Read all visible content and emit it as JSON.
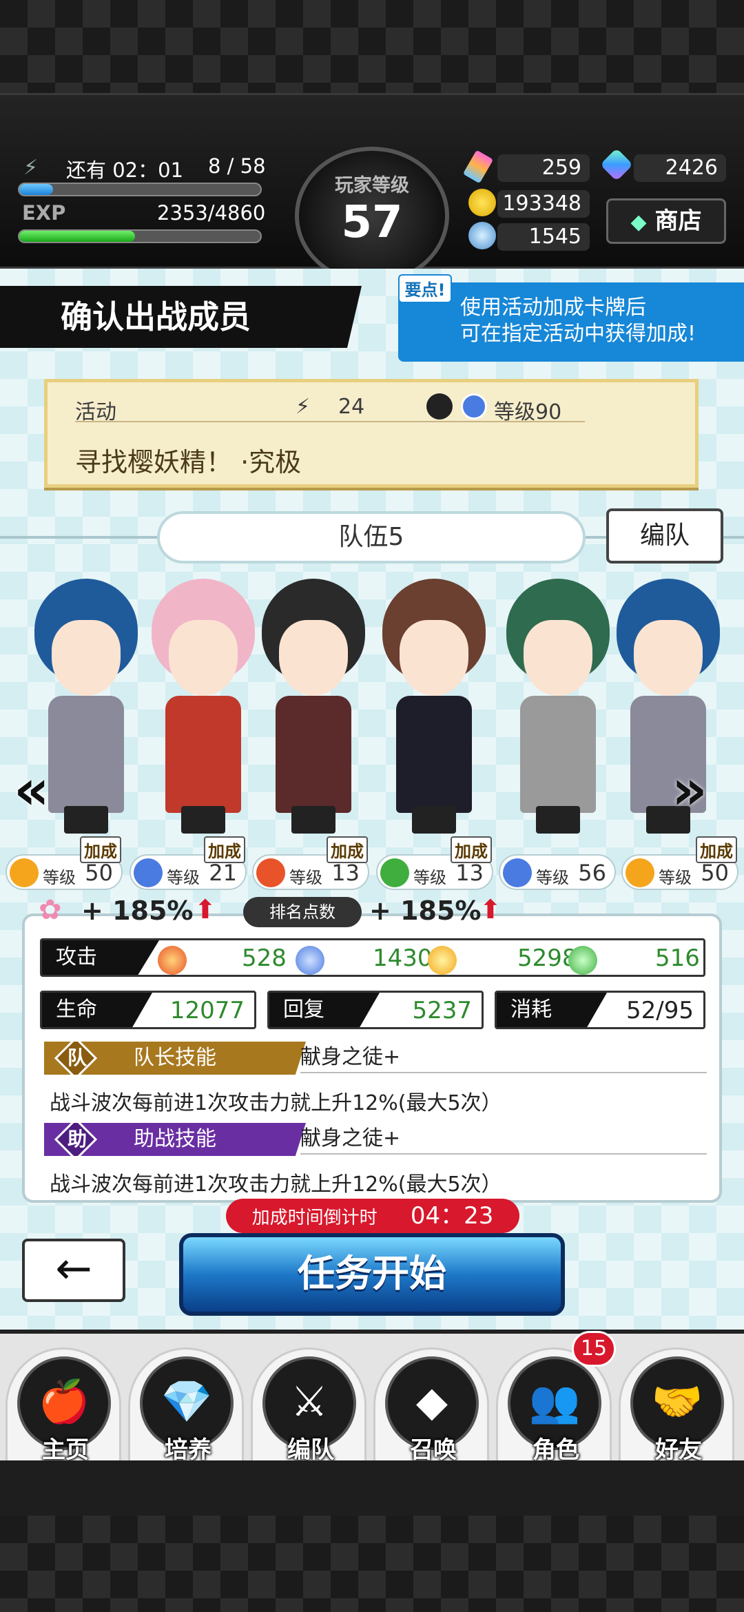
{
  "status": {
    "stamina_timer": "还有 02：01",
    "stamina_value": "8 / 58",
    "stamina_fraction": 0.14,
    "exp_label": "EXP",
    "exp_value": "2353/4860",
    "exp_fraction": 0.48,
    "level_label": "玩家等级",
    "level_value": "57",
    "resource_1": "259",
    "resource_gems": "2426",
    "resource_coins": "193348",
    "resource_orbs": "1545",
    "shop_label": "商店"
  },
  "header": {
    "title": "确认出战成员",
    "tip_badge": "要点!",
    "tip_line1": "使用活动加成卡牌后",
    "tip_line2": "可在指定活动中获得加成!"
  },
  "event": {
    "label": "活动",
    "stamina_cost": "24",
    "level_req": "等级90",
    "name": "寻找樱妖精！ ·究极"
  },
  "team": {
    "name": "队伍5",
    "edit_label": "编队",
    "bonus_tag": "加成",
    "level_prefix": "等级",
    "members": [
      {
        "level": "50",
        "element": "#f4a51c",
        "hair": "#1f5b9a",
        "outfit": "#8a8a9a"
      },
      {
        "level": "21",
        "element": "#4a7be0",
        "hair": "#f0b6c8",
        "outfit": "#c0392b"
      },
      {
        "level": "13",
        "element": "#e8532a",
        "hair": "#2a2a2a",
        "outfit": "#5b2a2a"
      },
      {
        "level": "13",
        "element": "#3fae3f",
        "hair": "#6b4030",
        "outfit": "#1e1e2a"
      },
      {
        "level": "56",
        "element": "#4a7be0",
        "hair": "#2f6b4e",
        "outfit": "#9a9a9a"
      },
      {
        "level": "50",
        "element": "#f4a51c",
        "hair": "#1f5b9a",
        "outfit": "#8a8a9a"
      }
    ]
  },
  "bonus": {
    "left_pct": "+ 185%",
    "rank_label": "排名点数",
    "right_pct": "+ 185%"
  },
  "stats": {
    "attack_label": "攻击",
    "attack_fire": "528",
    "attack_water": "1430",
    "attack_light": "5298",
    "attack_wind": "516",
    "hp_label": "生命",
    "hp_value": "12077",
    "recover_label": "回复",
    "recover_value": "5237",
    "cost_label": "消耗",
    "cost_value": "52/95"
  },
  "skills": {
    "leader_mark": "队",
    "leader_label": "队长技能",
    "leader_name": "献身之徒+",
    "leader_desc": "战斗波次每前进1次攻击力就上升12%(最大5次）",
    "support_mark": "助",
    "support_label": "助战技能",
    "support_name": "献身之徒+",
    "support_desc": "战斗波次每前进1次攻击力就上升12%(最大5次）"
  },
  "actions": {
    "timer_label": "加成时间倒计时",
    "timer_value": "04：23",
    "back_icon": "←",
    "start_label": "任务开始"
  },
  "nav": {
    "badge": "15",
    "items": [
      {
        "label": "主页",
        "icon": "🍎"
      },
      {
        "label": "培养",
        "icon": "💎"
      },
      {
        "label": "编队",
        "icon": "⚔"
      },
      {
        "label": "召唤",
        "icon": "◆"
      },
      {
        "label": "角色",
        "icon": "👥"
      },
      {
        "label": "好友",
        "icon": "🤝"
      }
    ]
  },
  "colors": {
    "accent_blue": "#1787d7",
    "timer_red": "#d8182c",
    "stat_green": "#2d8a2d"
  }
}
